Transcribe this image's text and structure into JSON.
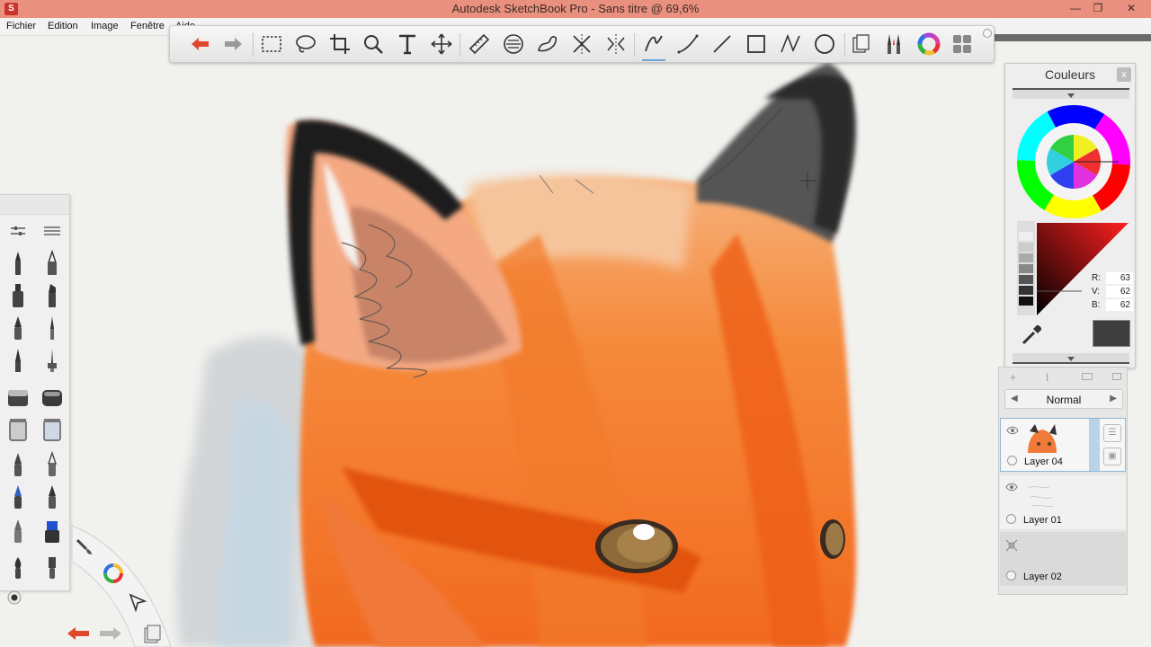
{
  "window": {
    "title": "Autodesk SketchBook Pro - Sans titre @ 69,6%",
    "app_icon_label": "S",
    "controls": {
      "minimize": "—",
      "maximize": "❐",
      "close": "✕"
    }
  },
  "menu": {
    "items": [
      "Fichier",
      "Edition",
      "Image",
      "Fenêtre",
      "Aide"
    ]
  },
  "toolbar": {
    "tools": [
      "undo",
      "redo",
      "select-rectangle",
      "lasso",
      "crop",
      "zoom",
      "text",
      "move-transform",
      "ruler",
      "ellipse-guide",
      "french-curve",
      "symmetry-x",
      "symmetry-y",
      "pencil-stroke",
      "curve-line",
      "straight-line",
      "rectangle",
      "polyline",
      "ellipse",
      "copy-paste",
      "brushes",
      "color-wheel",
      "palettes"
    ],
    "active_tool": "pencil-stroke"
  },
  "colors": {
    "panel_title": "Couleurs",
    "close": "x",
    "rgb": [
      {
        "label": "R:",
        "value": "63"
      },
      {
        "label": "V:",
        "value": "62"
      },
      {
        "label": "B:",
        "value": "62"
      }
    ],
    "current_color": "#3f3e3e"
  },
  "layers": {
    "blend_mode": "Normal",
    "items": [
      {
        "name": "Layer 04",
        "selected": true,
        "visible": true
      },
      {
        "name": "Layer 01",
        "selected": false,
        "visible": true
      },
      {
        "name": "Layer 02",
        "selected": false,
        "visible": false
      }
    ]
  },
  "accent": {
    "selection_blue": "#6aa6d8",
    "titlebar": "#e9917e"
  }
}
